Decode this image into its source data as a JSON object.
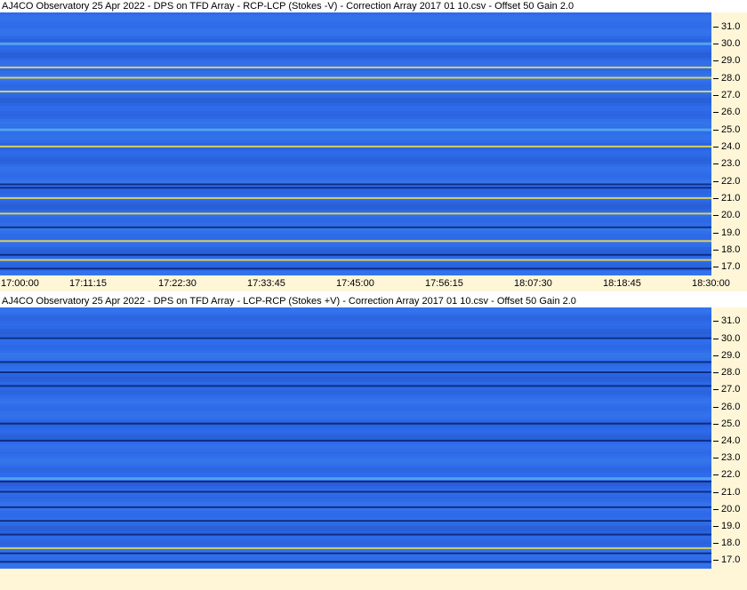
{
  "colors": {
    "background_blue": "#2f6bea",
    "dark_band": "#0a2878",
    "light_band": "#56a8ee",
    "yellow_line": "#f2e24c",
    "axis_panel": "#fff6d8"
  },
  "chart_data": [
    {
      "type": "heatmap",
      "title": "AJ4CO Observatory 25 Apr 2022  -  DPS on TFD Array  -  RCP-LCP (Stokes -V)  -  Correction Array 2017 01 10.csv  -  Offset 50  Gain 2.0",
      "xlabel": "",
      "ylabel": "",
      "x_range": [
        "17:00:00",
        "18:30:00"
      ],
      "x_ticks": [
        "17:00:00",
        "17:11:15",
        "17:22:30",
        "17:33:45",
        "17:45:00",
        "17:56:15",
        "18:07:30",
        "18:18:45",
        "18:30:00"
      ],
      "ylim": [
        16.5,
        31.8
      ],
      "y_ticks": [
        "31.0",
        "30.0",
        "29.0",
        "28.0",
        "27.0",
        "26.0",
        "25.0",
        "24.0",
        "23.0",
        "22.0",
        "21.0",
        "20.0",
        "19.0",
        "18.0",
        "17.0"
      ],
      "bands": [
        {
          "freq": 30.0,
          "kind": "light"
        },
        {
          "freq": 28.6,
          "kind": "yellow"
        },
        {
          "freq": 28.0,
          "kind": "yellow"
        },
        {
          "freq": 27.2,
          "kind": "yellow"
        },
        {
          "freq": 25.0,
          "kind": "light"
        },
        {
          "freq": 24.0,
          "kind": "yellow"
        },
        {
          "freq": 21.8,
          "kind": "dark"
        },
        {
          "freq": 21.6,
          "kind": "dark"
        },
        {
          "freq": 21.0,
          "kind": "yellow"
        },
        {
          "freq": 20.1,
          "kind": "yellow"
        },
        {
          "freq": 19.3,
          "kind": "dark"
        },
        {
          "freq": 18.5,
          "kind": "yellow"
        },
        {
          "freq": 17.7,
          "kind": "dark"
        },
        {
          "freq": 17.4,
          "kind": "yellow"
        },
        {
          "freq": 16.9,
          "kind": "dark"
        }
      ]
    },
    {
      "type": "heatmap",
      "title": "AJ4CO Observatory 25 Apr 2022  -  DPS on TFD Array  -  LCP-RCP (Stokes +V)  -  Correction Array 2017 01 10.csv  -  Offset 50  Gain 2.0",
      "xlabel": "",
      "ylabel": "",
      "x_range": [
        "17:00:00",
        "18:30:00"
      ],
      "ylim": [
        16.5,
        31.8
      ],
      "y_ticks": [
        "31.0",
        "30.0",
        "29.0",
        "28.0",
        "27.0",
        "26.0",
        "25.0",
        "24.0",
        "23.0",
        "22.0",
        "21.0",
        "20.0",
        "19.0",
        "18.0",
        "17.0"
      ],
      "bands": [
        {
          "freq": 30.0,
          "kind": "dark"
        },
        {
          "freq": 28.6,
          "kind": "dark"
        },
        {
          "freq": 28.0,
          "kind": "dark"
        },
        {
          "freq": 27.2,
          "kind": "dark"
        },
        {
          "freq": 25.0,
          "kind": "dark"
        },
        {
          "freq": 24.0,
          "kind": "dark"
        },
        {
          "freq": 21.8,
          "kind": "light"
        },
        {
          "freq": 21.6,
          "kind": "dark"
        },
        {
          "freq": 21.0,
          "kind": "dark"
        },
        {
          "freq": 20.1,
          "kind": "dark"
        },
        {
          "freq": 19.3,
          "kind": "dark"
        },
        {
          "freq": 18.5,
          "kind": "dark"
        },
        {
          "freq": 17.7,
          "kind": "yellow"
        },
        {
          "freq": 17.4,
          "kind": "dark"
        },
        {
          "freq": 16.9,
          "kind": "dark"
        }
      ]
    }
  ]
}
